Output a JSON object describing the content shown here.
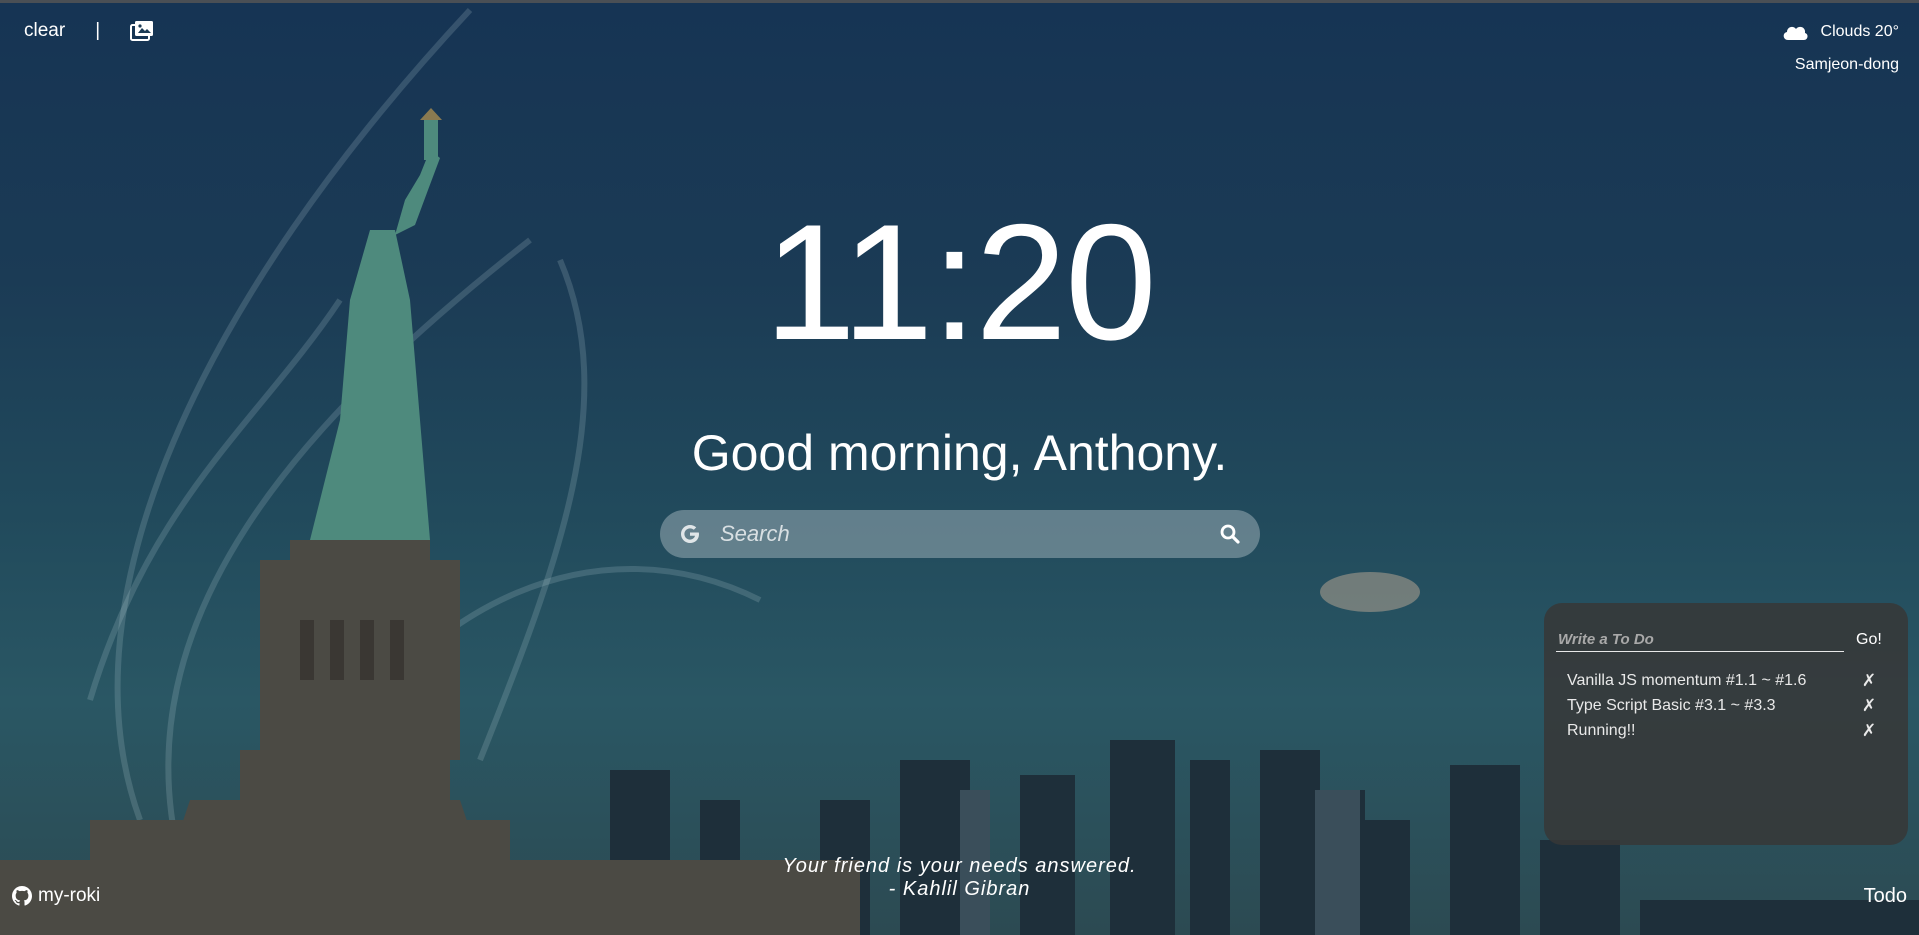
{
  "top_left": {
    "clear_label": "clear",
    "divider": "|",
    "background_icon": "image-gallery-icon"
  },
  "weather": {
    "icon": "cloud-icon",
    "text": "Clouds 20°",
    "location": "Samjeon-dong"
  },
  "clock": {
    "time": "11:20"
  },
  "greeting": {
    "text": "Good morning, Anthony."
  },
  "search": {
    "placeholder": "Search",
    "engine_icon": "google-g-icon",
    "submit_icon": "magnifier-icon"
  },
  "todo": {
    "input_placeholder": "Write a To Do",
    "submit_label": "Go!",
    "delete_symbol": "✗",
    "items": [
      {
        "text": "Vanilla JS momentum #1.1 ~ #1.6"
      },
      {
        "text": "Type Script Basic #3.1 ~ #3.3"
      },
      {
        "text": "Running!!"
      }
    ],
    "toggle_label": "Todo"
  },
  "quote": {
    "text": "Your friend is your needs answered.",
    "author": "- Kahlil Gibran"
  },
  "github": {
    "icon": "github-icon",
    "label": "my-roki"
  },
  "colors": {
    "background_top": "#163454",
    "background_bottom": "#2c4a52",
    "search_bar": "rgba(220,225,230,0.35)",
    "todo_panel": "rgba(55,55,55,0.85)",
    "text": "#ffffff"
  }
}
